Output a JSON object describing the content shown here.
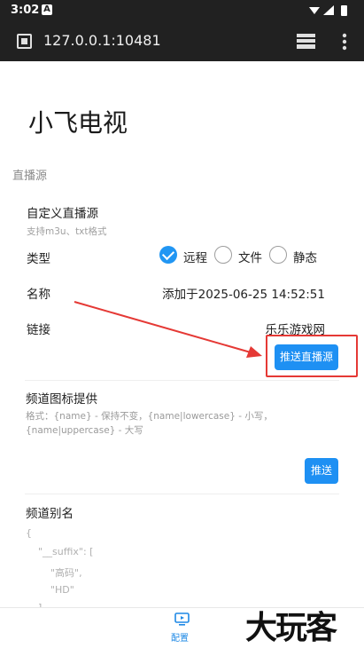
{
  "status_bar": {
    "time": "3:02",
    "notification": "A"
  },
  "browser": {
    "url": "127.0.0.1:10481"
  },
  "page": {
    "app_title": "小飞电视",
    "section_title": "直播源",
    "custom_source": {
      "label": "自定义直播源",
      "hint": "支持m3u、txt格式"
    },
    "type": {
      "label": "类型",
      "options": [
        "远程",
        "文件",
        "静态"
      ],
      "selected": "远程"
    },
    "name": {
      "label": "名称",
      "value": "添加于2025-06-25 14:52:51"
    },
    "link": {
      "label": "链接",
      "value": "乐乐游戏网",
      "push_button": "推送直播源"
    },
    "channel_icon": {
      "label": "频道图标提供",
      "hint": "格式：{name} - 保持不变，{name|lowercase} - 小写，{name|uppercase} - 大写",
      "push_button": "推送"
    },
    "channel_alias": {
      "label": "频道别名",
      "code_lines": [
        "{",
        "    \"__suffix\": [",
        "        \"高码\",",
        "        \"HD\"",
        "    ],"
      ]
    }
  },
  "bottom_nav": {
    "label": "配置",
    "icon": "monitor-icon"
  },
  "watermark": "大玩客",
  "colors": {
    "accent": "#1e90f3",
    "annotation": "#e53935"
  }
}
